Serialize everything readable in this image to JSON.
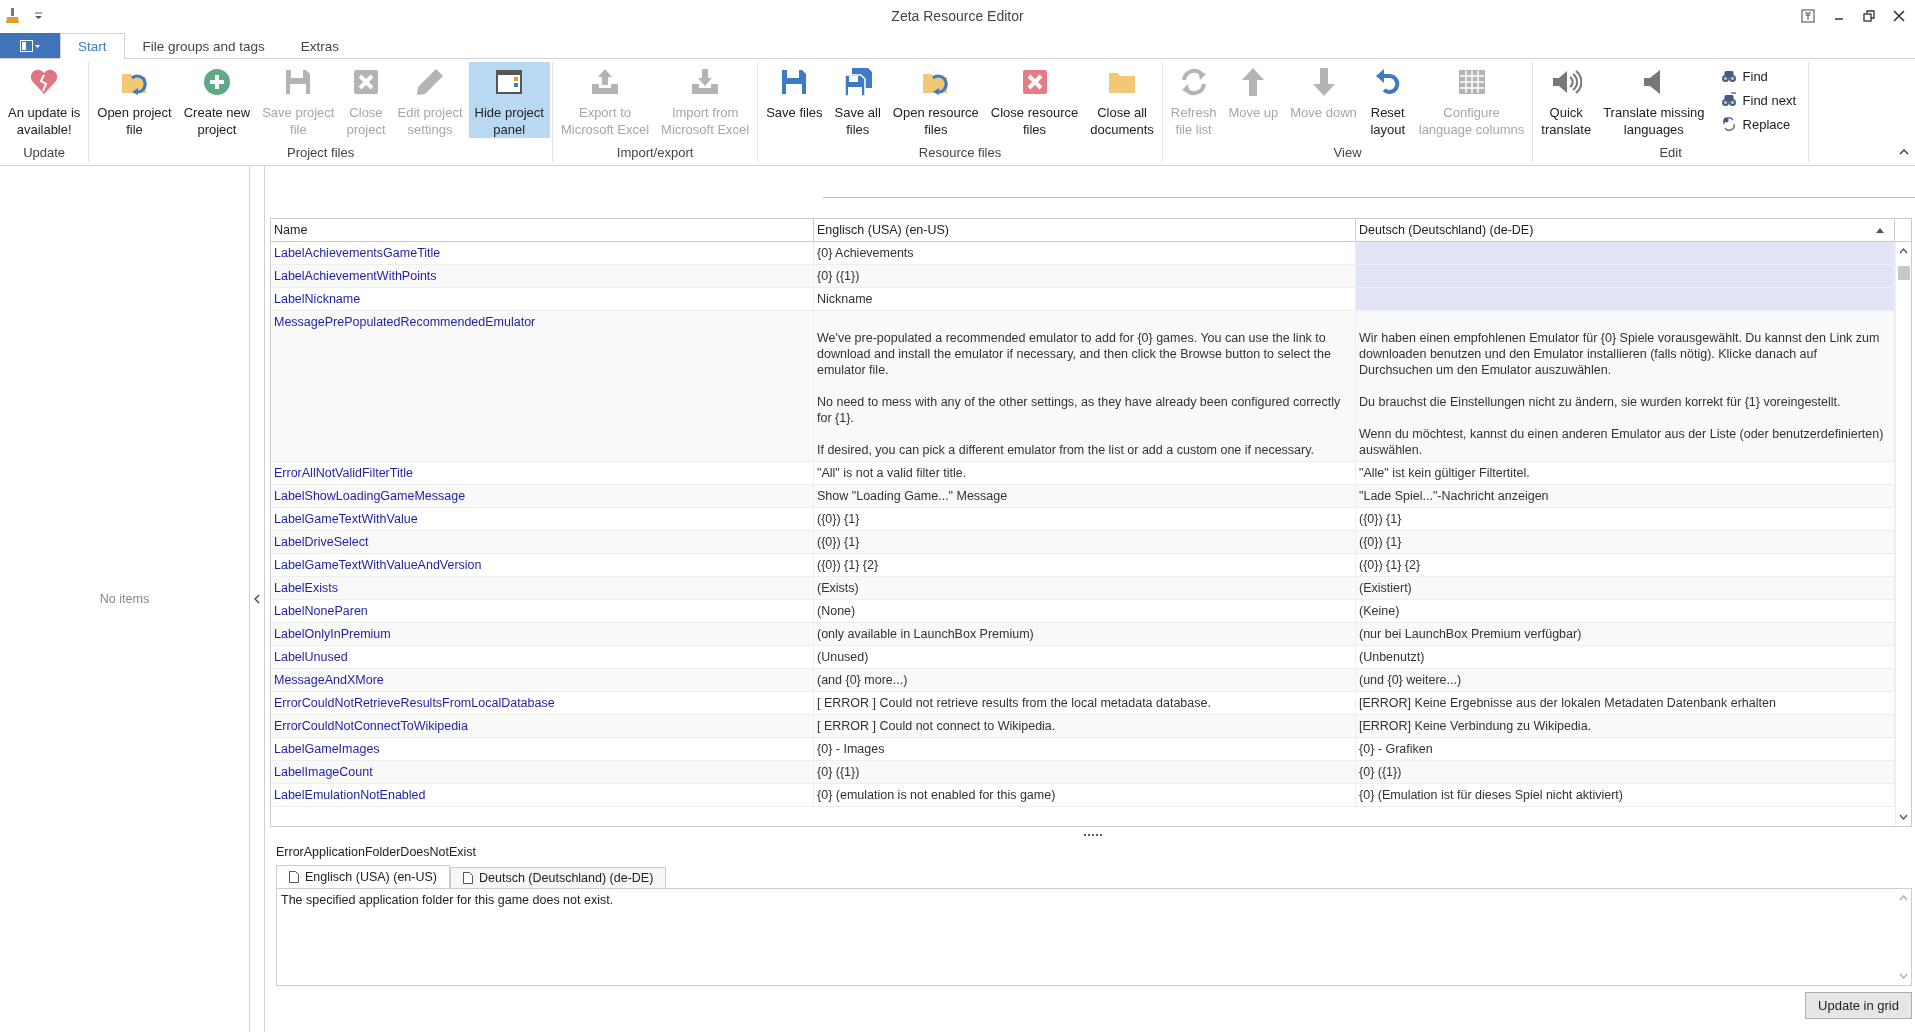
{
  "window": {
    "title": "Zeta Resource Editor"
  },
  "tabs": [
    {
      "label": "Start",
      "selected": true
    },
    {
      "label": "File groups and tags",
      "selected": false
    },
    {
      "label": "Extras",
      "selected": false
    }
  ],
  "ribbon": {
    "groups": [
      {
        "label": "Update",
        "items": [
          {
            "kind": "large",
            "label": "An update is\navailable!",
            "disabled": false,
            "selected": false
          }
        ]
      },
      {
        "label": "Project files",
        "items": [
          {
            "kind": "large",
            "label": "Open project\nfile",
            "disabled": false,
            "selected": false
          },
          {
            "kind": "large",
            "label": "Create new\nproject",
            "disabled": false,
            "selected": false
          },
          {
            "kind": "large",
            "label": "Save project\nfile",
            "disabled": true,
            "selected": false
          },
          {
            "kind": "large",
            "label": "Close\nproject",
            "disabled": true,
            "selected": false
          },
          {
            "kind": "large",
            "label": "Edit project\nsettings",
            "disabled": true,
            "selected": false
          },
          {
            "kind": "large",
            "label": "Hide project\npanel",
            "disabled": false,
            "selected": true
          }
        ]
      },
      {
        "label": "Import/export",
        "items": [
          {
            "kind": "large",
            "label": "Export to\nMicrosoft Excel",
            "disabled": true,
            "selected": false
          },
          {
            "kind": "large",
            "label": "Import from\nMicrosoft Excel",
            "disabled": true,
            "selected": false
          }
        ]
      },
      {
        "label": "Resource files",
        "items": [
          {
            "kind": "large",
            "label": "Save files",
            "disabled": false,
            "selected": false
          },
          {
            "kind": "large",
            "label": "Save all\nfiles",
            "disabled": false,
            "selected": false
          },
          {
            "kind": "large",
            "label": "Open resource\nfiles",
            "disabled": false,
            "selected": false
          },
          {
            "kind": "large",
            "label": "Close resource\nfiles",
            "disabled": false,
            "selected": false
          },
          {
            "kind": "large",
            "label": "Close all\ndocuments",
            "disabled": false,
            "selected": false
          }
        ]
      },
      {
        "label": "View",
        "items": [
          {
            "kind": "large",
            "label": "Refresh\nfile list",
            "disabled": true,
            "selected": false
          },
          {
            "kind": "large",
            "label": "Move up",
            "disabled": true,
            "selected": false
          },
          {
            "kind": "large",
            "label": "Move down",
            "disabled": true,
            "selected": false
          },
          {
            "kind": "large",
            "label": "Reset\nlayout",
            "disabled": false,
            "selected": false
          },
          {
            "kind": "large",
            "label": "Configure\nlanguage columns",
            "disabled": true,
            "selected": false
          }
        ]
      },
      {
        "label": "Edit",
        "items": [
          {
            "kind": "large",
            "label": "Quick\ntranslate",
            "disabled": false,
            "selected": false
          },
          {
            "kind": "large",
            "label": "Translate missing\nlanguages",
            "disabled": false,
            "selected": false
          },
          {
            "kind": "small",
            "label": "Find",
            "disabled": false,
            "selected": false
          },
          {
            "kind": "small",
            "label": "Find next",
            "disabled": false,
            "selected": false
          },
          {
            "kind": "small",
            "label": "Replace",
            "disabled": false,
            "selected": false
          }
        ]
      }
    ]
  },
  "project_panel": {
    "empty_text": "No items"
  },
  "grid": {
    "columns": [
      "Name",
      "Englisch (USA) (en-US)",
      "Deutsch (Deutschland) (de-DE)"
    ],
    "rows": [
      {
        "name": "LabelAchievementsGameTitle",
        "en": "{0} Achievements",
        "missing": true
      },
      {
        "name": "LabelAchievementWithPoints",
        "en": "{0} ({1})",
        "missing": true
      },
      {
        "name": "LabelNickname",
        "en": "Nickname",
        "missing": true
      },
      {
        "name": "MessagePrePopulatedRecommendedEmulator",
        "en": "We've pre-populated a recommended emulator to add for {0} games. You can use the link to download and install the emulator if necessary, and then click the Browse button to select the emulator file.\n\nNo need to mess with any of the other settings, as they have already been configured correctly for {1}.\n\nIf desired, you can pick a different emulator from the list or add a custom one if necessary.",
        "de": "Wir haben einen empfohlenen Emulator für {0} Spiele vorausgewählt. Du kannst den Link zum downloaden benutzen und den Emulator installieren (falls nötig). Klicke danach auf Durchsuchen um den Emulator auszuwählen.\n\nDu brauchst die Einstellungen nicht zu ändern, sie wurden korrekt für {1} voreingestellt.\n\nWenn du möchtest, kannst du einen anderen Emulator aus der Liste (oder benutzerdefinierten) auswählen.",
        "missing": false
      },
      {
        "name": "ErrorAllNotValidFilterTitle",
        "en": "\"All\" is not a valid filter title.",
        "de": "\"Alle\" ist kein gültiger Filtertitel.",
        "missing": false
      },
      {
        "name": "LabelShowLoadingGameMessage",
        "en": "Show \"Loading Game...\" Message",
        "de": "\"Lade Spiel...\"-Nachricht anzeigen",
        "missing": false
      },
      {
        "name": "LabelGameTextWithValue",
        "en": "({0}) {1}",
        "de": "({0}) {1}",
        "missing": false
      },
      {
        "name": "LabelDriveSelect",
        "en": "({0}) {1}",
        "de": "({0}) {1}",
        "missing": false
      },
      {
        "name": "LabelGameTextWithValueAndVersion",
        "en": "({0}) {1} {2}",
        "de": "({0}) {1} {2}",
        "missing": false
      },
      {
        "name": "LabelExists",
        "en": "(Exists)",
        "de": "(Existiert)",
        "missing": false
      },
      {
        "name": "LabelNoneParen",
        "en": "(None)",
        "de": "(Keine)",
        "missing": false
      },
      {
        "name": "LabelOnlyInPremium",
        "en": "(only available in LaunchBox Premium)",
        "de": "(nur bei LaunchBox Premium verfügbar)",
        "missing": false
      },
      {
        "name": "LabelUnused",
        "en": "(Unused)",
        "de": "(Unbenutzt)",
        "missing": false
      },
      {
        "name": "MessageAndXMore",
        "en": "(and {0} more...)",
        "de": "(und {0} weitere...)",
        "missing": false
      },
      {
        "name": "ErrorCouldNotRetrieveResultsFromLocalDatabase",
        "en": "[ ERROR ] Could not retrieve results from the local metadata database.",
        "de": "[ERROR] Keine Ergebnisse aus der lokalen Metadaten Datenbank erhalten",
        "missing": false
      },
      {
        "name": "ErrorCouldNotConnectToWikipedia",
        "en": "[ ERROR ] Could not connect to Wikipedia.",
        "de": "[ERROR] Keine Verbindung zu Wikipedia.",
        "missing": false
      },
      {
        "name": "LabelGameImages",
        "en": "{0} - Images",
        "de": "{0} - Grafiken",
        "missing": false
      },
      {
        "name": "LabelImageCount",
        "en": "{0} ({1})",
        "de": "{0} ({1})",
        "missing": false
      },
      {
        "name": "LabelEmulationNotEnabled",
        "en": "{0} (emulation is not enabled for this game)",
        "de": "{0} (Emulation ist für dieses Spiel nicht aktiviert)",
        "missing": false
      }
    ]
  },
  "editor": {
    "key": "ErrorApplicationFolderDoesNotExist",
    "tabs": [
      {
        "label": "Englisch (USA) (en-US)",
        "selected": true
      },
      {
        "label": "Deutsch (Deutschland) (de-DE)",
        "selected": false
      }
    ],
    "value": "The specified application folder for this game does not exist.",
    "button": "Update in grid"
  }
}
